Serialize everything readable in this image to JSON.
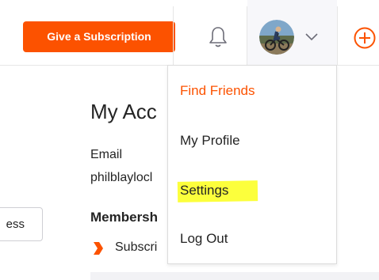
{
  "topbar": {
    "give_subscription_label": "Give a Subscription",
    "icons": [
      "bell-icon",
      "avatar",
      "chevron-down-icon",
      "plus-circle-icon"
    ],
    "accent_color": "#fc5200"
  },
  "main": {
    "title": "My Acc",
    "email_label": "Email",
    "email_value": "philblaylocl",
    "membership_label": "Membersh",
    "subscription_text": "Subscri",
    "left_button_label": "ess"
  },
  "dropdown": {
    "items": [
      {
        "label": "Find Friends",
        "active": true
      },
      {
        "label": "My Profile",
        "active": false
      },
      {
        "label": "Settings",
        "active": false,
        "highlighted": true
      },
      {
        "label": "Log Out",
        "active": false
      }
    ],
    "highlight_color": "#fcff3c"
  }
}
